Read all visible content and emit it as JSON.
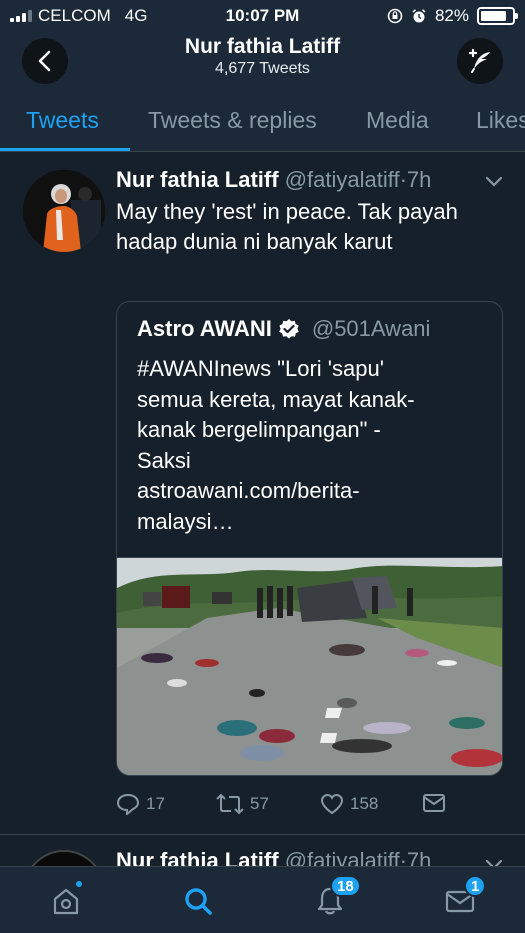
{
  "status_bar": {
    "carrier": "CELCOM",
    "network": "4G",
    "time": "10:07 PM",
    "battery": "82%",
    "battery_level": 0.82
  },
  "header": {
    "title": "Nur fathia Latiff",
    "subtitle": "4,677 Tweets"
  },
  "tabs": [
    {
      "label": "Tweets",
      "active": true
    },
    {
      "label": "Tweets & replies",
      "active": false
    },
    {
      "label": "Media",
      "active": false
    },
    {
      "label": "Likes",
      "active": false
    }
  ],
  "tweet": {
    "name": "Nur fathia Latiff",
    "handle": "@fatiyalatiff",
    "separator": "·",
    "time": "7h",
    "text": "May they 'rest' in peace. Tak payah hadap dunia ni banyak karut",
    "quote": {
      "name": "Astro AWANI",
      "handle": "@501Awani",
      "text_lines": [
        "#AWANInews \"Lori 'sapu'",
        "semua kereta, mayat kanak-",
        "kanak bergelimpangan\" -",
        "Saksi",
        "astroawani.com/berita-",
        "malaysi…"
      ]
    },
    "actions": {
      "replies": "17",
      "retweets": "57",
      "likes": "158"
    }
  },
  "next_tweet": {
    "name": "Nur fathia Latiff",
    "handle": "@fatiyalatiff",
    "separator": "·",
    "time": "7h"
  },
  "bottom_nav": {
    "notifications_badge": "18",
    "messages_badge": "1"
  },
  "colors": {
    "background": "#15202b",
    "bar": "#1c2938",
    "accent": "#1da1f2",
    "muted": "#8899a6",
    "divider": "#38444d"
  }
}
